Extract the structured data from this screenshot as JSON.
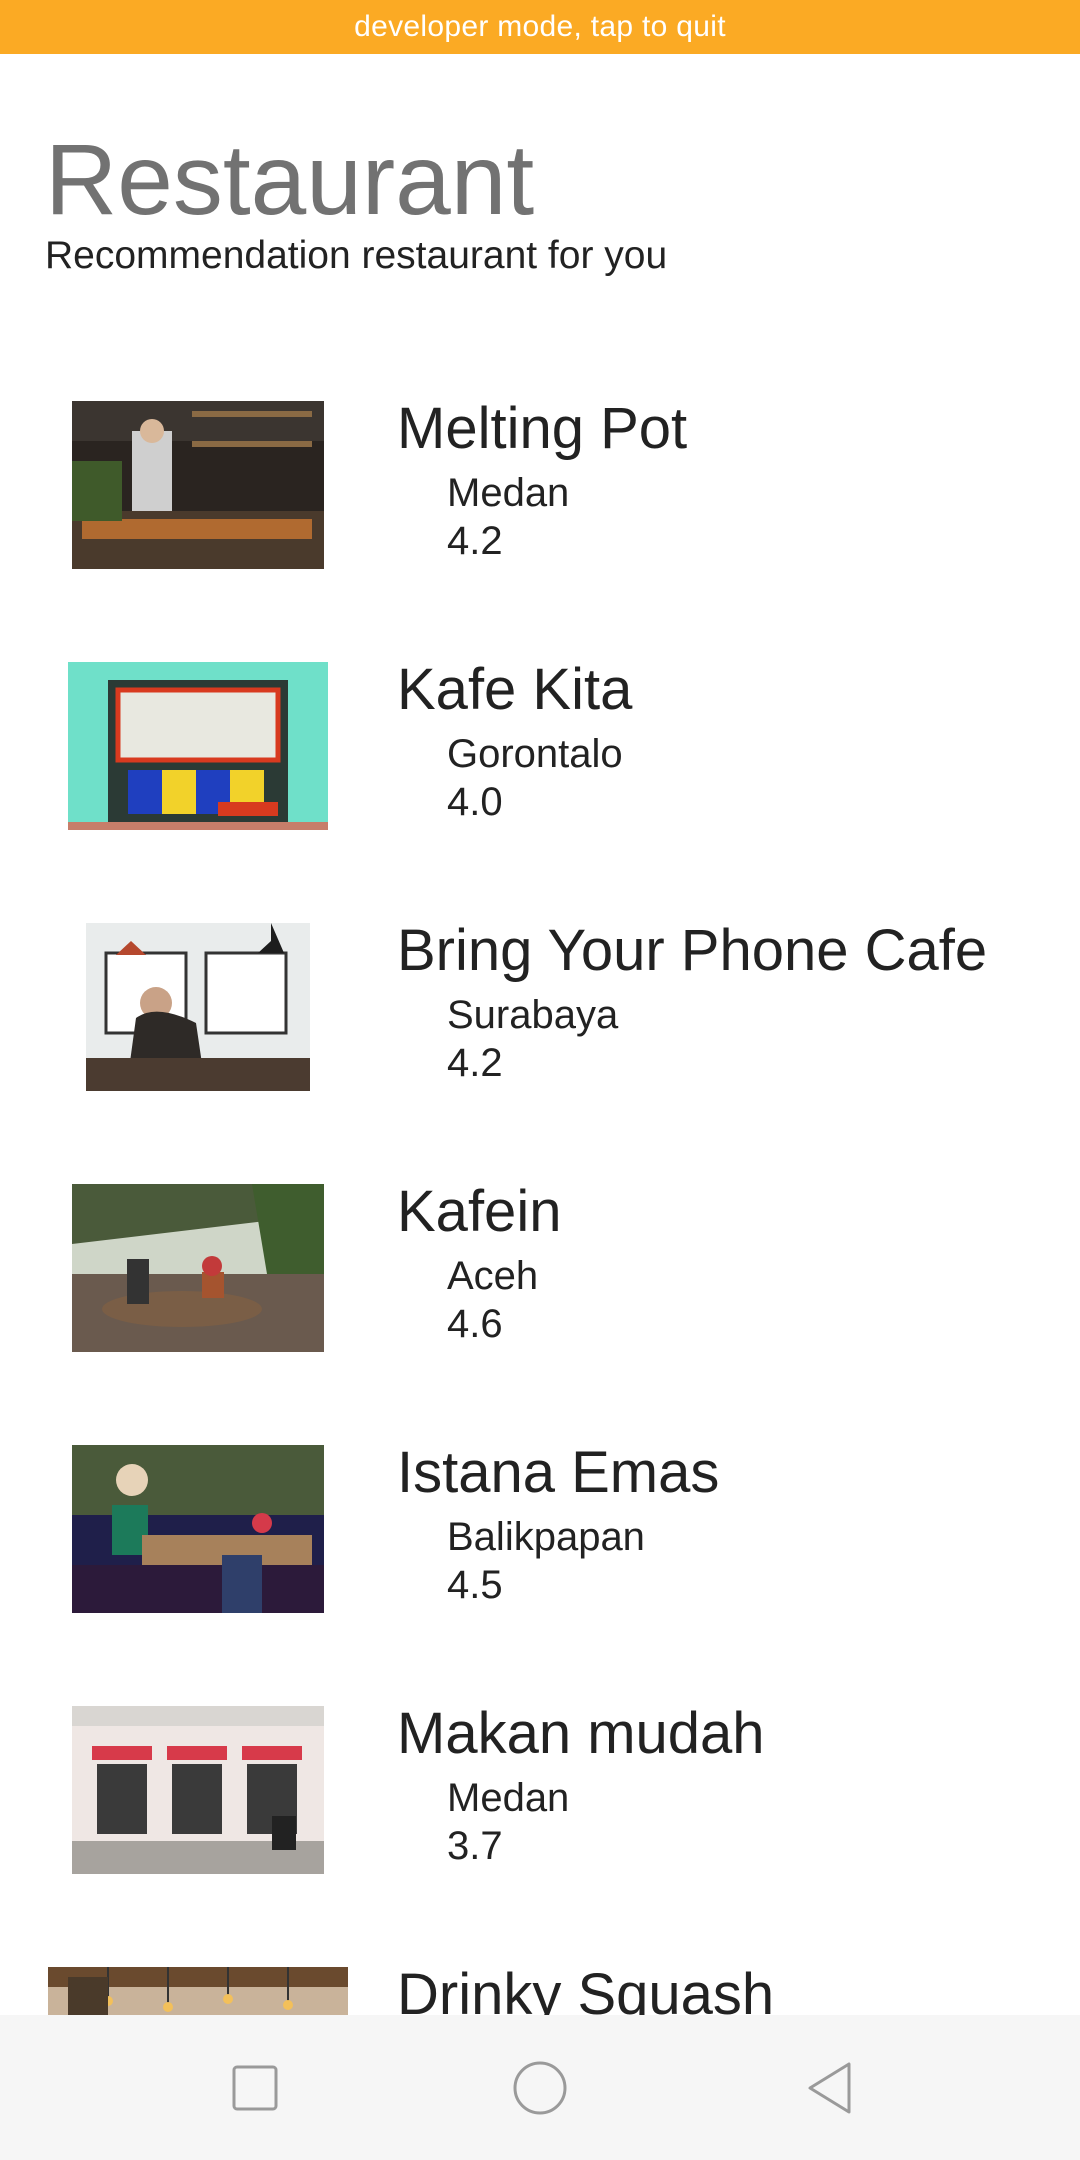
{
  "banner": {
    "text": "developer mode, tap to quit"
  },
  "header": {
    "title": "Restaurant",
    "subtitle": "Recommendation restaurant for you"
  },
  "restaurants": [
    {
      "name": "Melting Pot",
      "city": "Medan",
      "rating": "4.2"
    },
    {
      "name": "Kafe Kita",
      "city": "Gorontalo",
      "rating": "4.0"
    },
    {
      "name": "Bring Your Phone Cafe",
      "city": "Surabaya",
      "rating": "4.2"
    },
    {
      "name": "Kafein",
      "city": "Aceh",
      "rating": "4.6"
    },
    {
      "name": "Istana Emas",
      "city": "Balikpapan",
      "rating": "4.5"
    },
    {
      "name": "Makan mudah",
      "city": "Medan",
      "rating": "3.7"
    },
    {
      "name": "Drinky Squash",
      "city": "",
      "rating": ""
    }
  ],
  "navbar": {
    "recent_icon": "square-icon",
    "home_icon": "circle-icon",
    "back_icon": "triangle-back-icon"
  },
  "colors": {
    "banner": "#FBAA24",
    "title": "#727272",
    "text": "#222222",
    "navbar": "#F6F6F6"
  }
}
